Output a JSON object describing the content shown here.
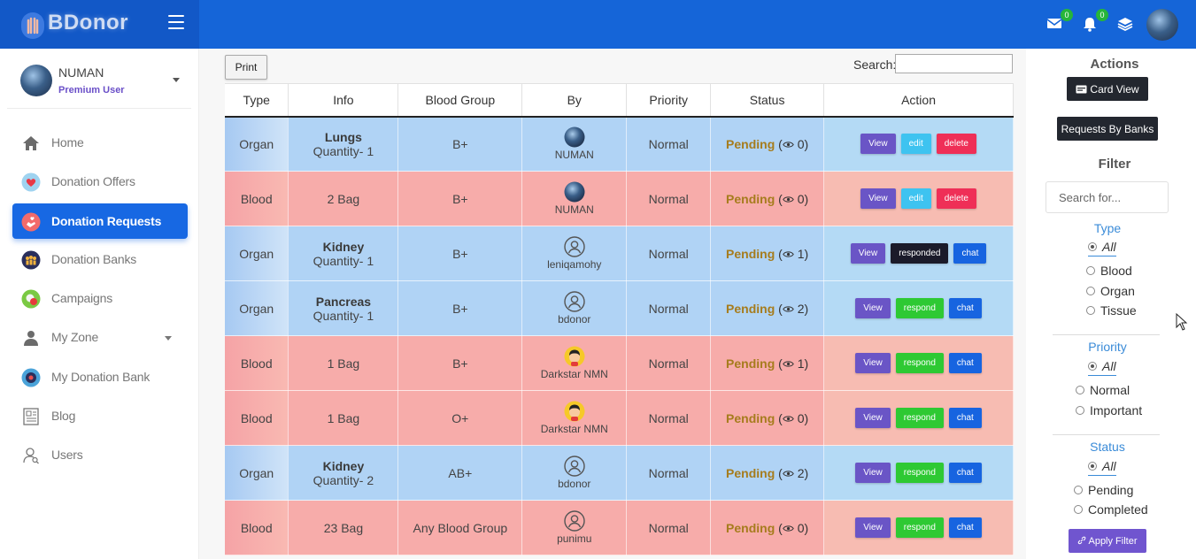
{
  "brand": {
    "name": "BDonor"
  },
  "header": {
    "mail_count": "0",
    "notif_count": "0"
  },
  "sidebar": {
    "user": {
      "name": "NUMAN",
      "role": "Premium User"
    },
    "items": [
      {
        "label": "Home",
        "icon": "home-icon"
      },
      {
        "label": "Donation Offers",
        "icon": "heart-icon"
      },
      {
        "label": "Donation Requests",
        "icon": "hand-heart-icon",
        "active": true
      },
      {
        "label": "Donation Banks",
        "icon": "people-icon"
      },
      {
        "label": "Campaigns",
        "icon": "campaign-icon"
      },
      {
        "label": "My Zone",
        "icon": "user-icon"
      },
      {
        "label": "My Donation Bank",
        "icon": "bank-icon"
      },
      {
        "label": "Blog",
        "icon": "blog-icon"
      },
      {
        "label": "Users",
        "icon": "users-icon"
      }
    ]
  },
  "toolbar": {
    "print_label": "Print",
    "search_label": "Search:",
    "search_value": ""
  },
  "table": {
    "headers": [
      "Type",
      "Info",
      "Blood Group",
      "By",
      "Priority",
      "Status",
      "Action"
    ],
    "rows": [
      {
        "kind": "organ",
        "type": "Organ",
        "info_main": "Lungs",
        "info_sub": "Quantity- 1",
        "blood_group": "B+",
        "by": "NUMAN",
        "avatar": "photo",
        "priority": "Normal",
        "status": "Pending",
        "views": "0",
        "actions": [
          "View",
          "edit",
          "delete"
        ]
      },
      {
        "kind": "blood",
        "type": "Blood",
        "info_main": "",
        "info_sub": "2 Bag",
        "blood_group": "B+",
        "by": "NUMAN",
        "avatar": "photo",
        "priority": "Normal",
        "status": "Pending",
        "views": "0",
        "actions": [
          "View",
          "edit",
          "delete"
        ]
      },
      {
        "kind": "organ",
        "type": "Organ",
        "info_main": "Kidney",
        "info_sub": "Quantity- 1",
        "blood_group": "B+",
        "by": "leniqamohy",
        "avatar": "outline",
        "priority": "Normal",
        "status": "Pending",
        "views": "1",
        "actions": [
          "View",
          "responded",
          "chat"
        ]
      },
      {
        "kind": "organ",
        "type": "Organ",
        "info_main": "Pancreas",
        "info_sub": "Quantity- 1",
        "blood_group": "B+",
        "by": "bdonor",
        "avatar": "outline",
        "priority": "Normal",
        "status": "Pending",
        "views": "2",
        "actions": [
          "View",
          "respond",
          "chat"
        ]
      },
      {
        "kind": "blood",
        "type": "Blood",
        "info_main": "",
        "info_sub": "1 Bag",
        "blood_group": "B+",
        "by": "Darkstar NMN",
        "avatar": "cartoon",
        "priority": "Normal",
        "status": "Pending",
        "views": "1",
        "actions": [
          "View",
          "respond",
          "chat"
        ]
      },
      {
        "kind": "blood",
        "type": "Blood",
        "info_main": "",
        "info_sub": "1 Bag",
        "blood_group": "O+",
        "by": "Darkstar NMN",
        "avatar": "cartoon",
        "priority": "Normal",
        "status": "Pending",
        "views": "0",
        "actions": [
          "View",
          "respond",
          "chat"
        ]
      },
      {
        "kind": "organ",
        "type": "Organ",
        "info_main": "Kidney",
        "info_sub": "Quantity- 2",
        "blood_group": "AB+",
        "by": "bdonor",
        "avatar": "outline",
        "priority": "Normal",
        "status": "Pending",
        "views": "2",
        "actions": [
          "View",
          "respond",
          "chat"
        ]
      },
      {
        "kind": "blood",
        "type": "Blood",
        "info_main": "",
        "info_sub": "23 Bag",
        "blood_group": "Any Blood Group",
        "by": "punimu",
        "avatar": "outline",
        "priority": "Normal",
        "status": "Pending",
        "views": "0",
        "actions": [
          "View",
          "respond",
          "chat"
        ]
      }
    ]
  },
  "right_panel": {
    "actions_title": "Actions",
    "card_view_label": "Card View",
    "requests_by_banks_label": "Requests By Banks",
    "filter_title": "Filter",
    "filter_search_placeholder": "Search for...",
    "type": {
      "title": "Type",
      "options": [
        "All",
        "Blood",
        "Organ",
        "Tissue"
      ],
      "selected": "All"
    },
    "priority": {
      "title": "Priority",
      "options": [
        "All",
        "Normal",
        "Important"
      ],
      "selected": "All"
    },
    "status": {
      "title": "Status",
      "options": [
        "All",
        "Pending",
        "Completed"
      ],
      "selected": "All"
    },
    "apply_label": "Apply Filter"
  }
}
